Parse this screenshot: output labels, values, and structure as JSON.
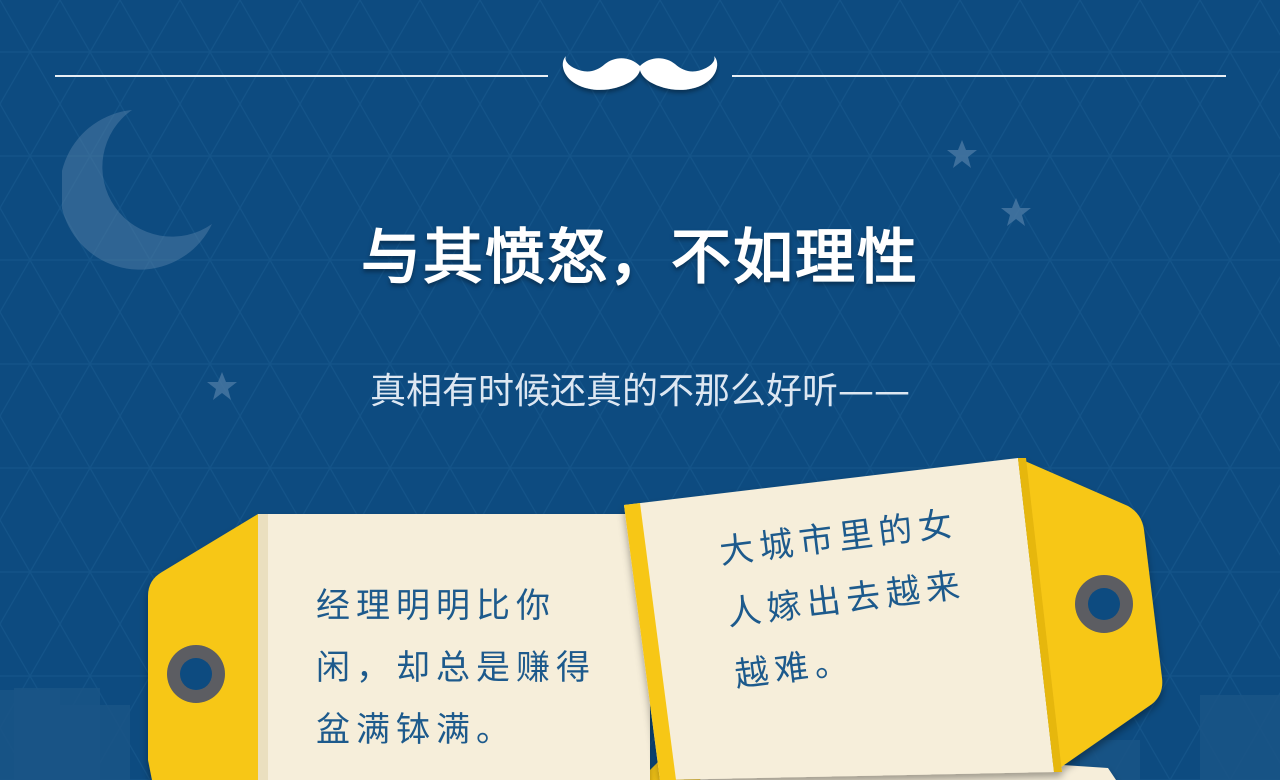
{
  "title": "与其愤怒，不如理性",
  "subtitle": "真相有时候还真的不那么好听——",
  "tags": [
    {
      "lines": [
        "经理明明比你",
        "闲，却总是赚得",
        "盆满钵满。"
      ]
    },
    {
      "lines": [
        "大城市里的女",
        "人嫁出去越来",
        "越难。"
      ]
    }
  ],
  "colors": {
    "background": "#0d4b80",
    "tag_paper": "#f6eeda",
    "tag_yellow": "#f7c718",
    "text_blue": "#1d5a8c"
  },
  "icons": [
    "mustache-icon",
    "moon-icon",
    "star-icon"
  ]
}
